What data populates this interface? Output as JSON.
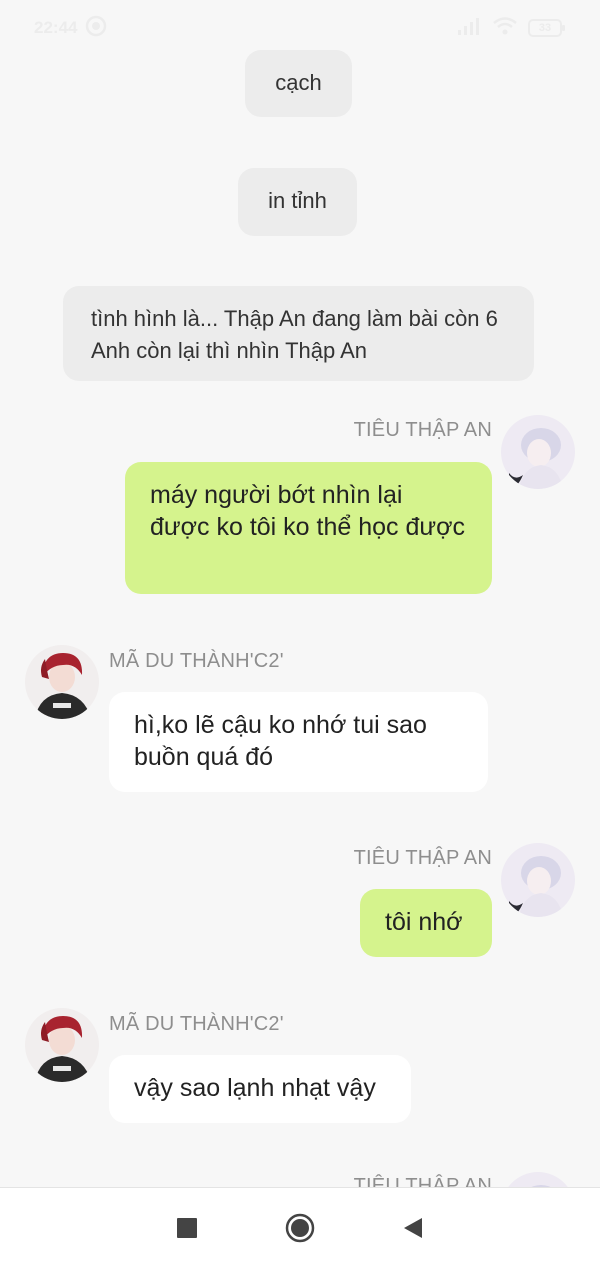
{
  "status_bar": {
    "time": "22:44",
    "battery": "33"
  },
  "messages": {
    "system": [
      {
        "text": "cạch"
      },
      {
        "text": "in tỉnh"
      },
      {
        "text": "tình hình là... Thập An đang làm bài còn 6 Anh còn lại thì nhìn Thập An"
      }
    ],
    "me_name": "TIÊU THẬP AN",
    "other_name": "MÃ DU THÀNH'C2'",
    "chat": [
      {
        "sender": "me",
        "text": "máy người bớt nhìn lại được ko tôi ko thể học được"
      },
      {
        "sender": "other",
        "text": "hì,ko lẽ cậu ko nhớ tui sao buồn quá đó"
      },
      {
        "sender": "me",
        "text": "tôi nhớ"
      },
      {
        "sender": "other",
        "text": "vậy sao lạnh nhạt vậy"
      }
    ]
  },
  "nav": {
    "recents": "recents-icon",
    "home": "home-icon",
    "back": "back-icon"
  },
  "colors": {
    "background": "#f7f7f7",
    "my_bubble": "#d5f38d",
    "other_bubble": "#ffffff",
    "system_bubble": "#ececec",
    "name_text": "#8e8e8e"
  }
}
